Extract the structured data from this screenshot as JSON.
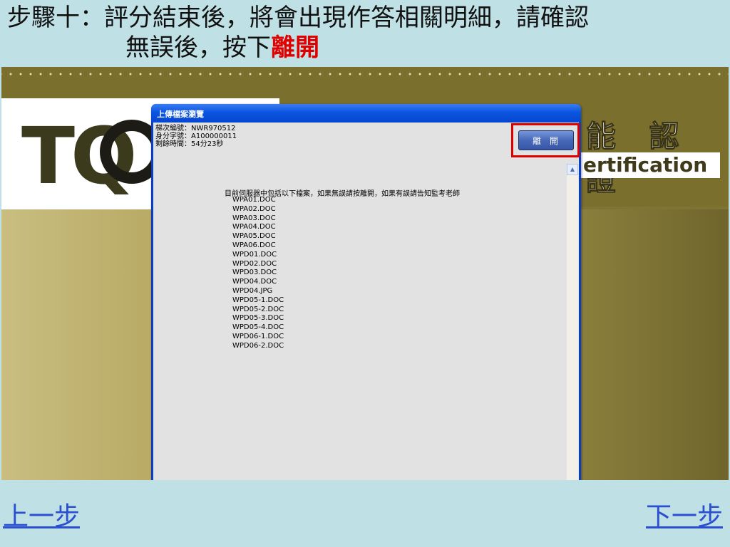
{
  "slide": {
    "title_line1": "步驟十：評分結束後，將會出現作答相關明細，請確認",
    "title_line2": "無誤後，按下",
    "title_highlight": "離開"
  },
  "banner": {
    "logo_letters": "TQ",
    "chars": "能 認 證",
    "cert_text": "ertification"
  },
  "dialog": {
    "title": "上傳檔案瀏覽",
    "batch_line": "梯次編號：NWR970512",
    "id_line": "身分字號：A100000011",
    "time_line": "剩餘時間：54分23秒",
    "leave_button": "離開",
    "intro": "目前伺服器中包括以下檔案，如果無誤請按離開，如果有誤請告知監考老師",
    "files": [
      "WPA01.DOC",
      "WPA02.DOC",
      "WPA03.DOC",
      "WPA04.DOC",
      "WPA05.DOC",
      "WPA06.DOC",
      "WPD01.DOC",
      "WPD02.DOC",
      "WPD03.DOC",
      "WPD04.DOC",
      "WPD04.JPG",
      "WPD05-1.DOC",
      "WPD05-2.DOC",
      "WPD05-3.DOC",
      "WPD05-4.DOC",
      "WPD06-1.DOC",
      "WPD06-2.DOC"
    ]
  },
  "nav": {
    "prev": "上一步",
    "next": "下一步"
  },
  "colors": {
    "highlight": "#e00000",
    "link": "#2a4fd0",
    "olive": "#7b6f2e"
  }
}
